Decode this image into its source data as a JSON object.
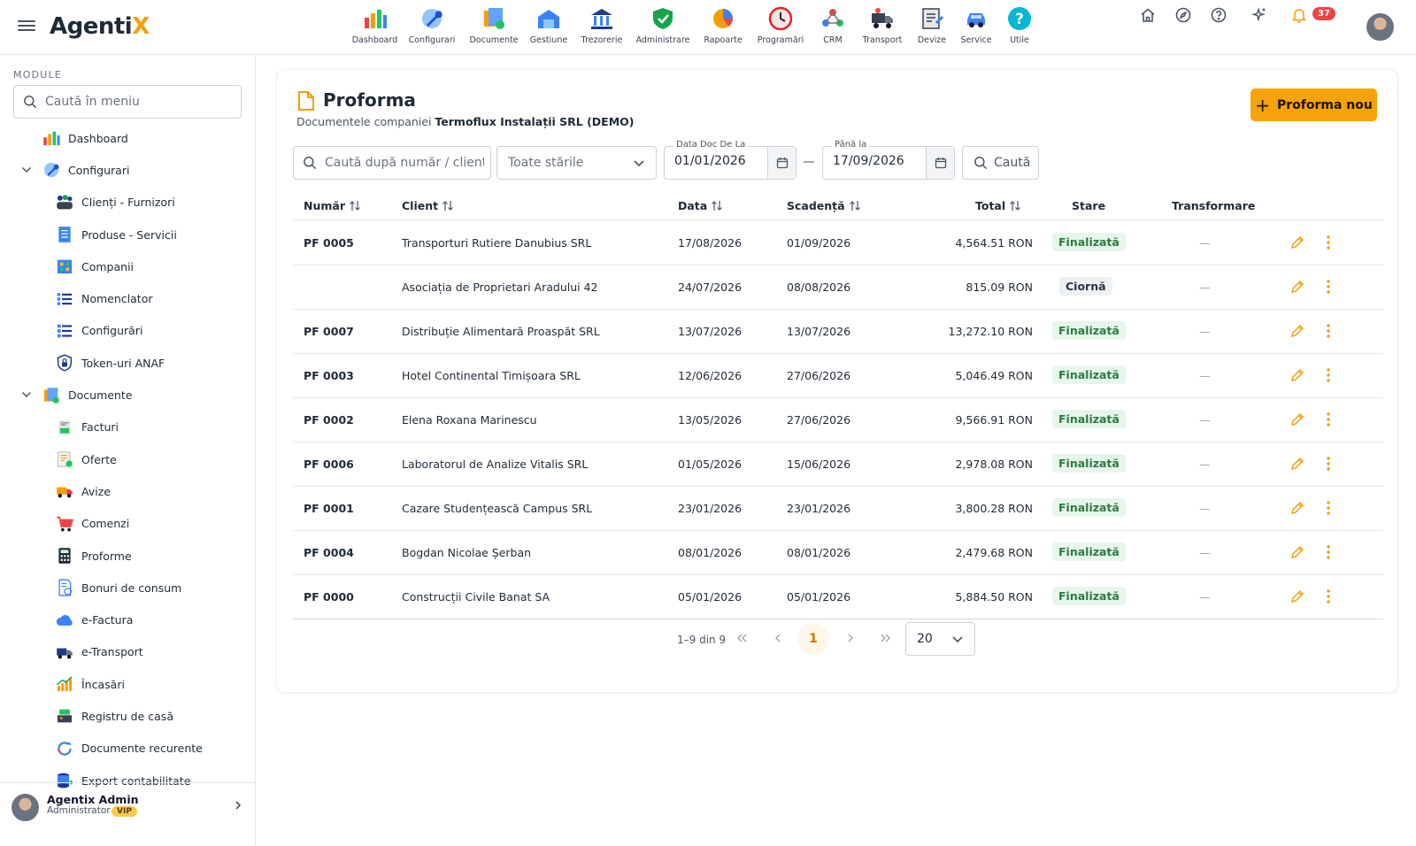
{
  "app": {
    "brand_main": "Agenti",
    "brand_accent": "X",
    "accent_color": "#f59e0b"
  },
  "topnav": [
    {
      "label": "Dashboard",
      "icon": "dashboard-icon"
    },
    {
      "label": "Configurari",
      "icon": "wrench-icon"
    },
    {
      "label": "Documente",
      "icon": "documents-icon"
    },
    {
      "label": "Gestiune",
      "icon": "warehouse-icon"
    },
    {
      "label": "Trezorerie",
      "icon": "bank-icon"
    },
    {
      "label": "Administrare",
      "icon": "shield-icon"
    },
    {
      "label": "Rapoarte",
      "icon": "pie-chart-icon"
    },
    {
      "label": "Programări",
      "icon": "clock-icon"
    },
    {
      "label": "CRM",
      "icon": "crm-icon"
    },
    {
      "label": "Transport",
      "icon": "truck-icon"
    },
    {
      "label": "Devize",
      "icon": "estimate-icon"
    },
    {
      "label": "Service",
      "icon": "car-service-icon"
    },
    {
      "label": "Utile",
      "icon": "help-icon"
    }
  ],
  "topright": {
    "notifications": "37"
  },
  "sidebar": {
    "module_label": "MODULE",
    "search_placeholder": "Caută în meniu",
    "items": [
      {
        "label": "Dashboard",
        "level": 0,
        "icon": "dashboard-icon"
      },
      {
        "label": "Configurari",
        "level": 0,
        "icon": "wrench-icon",
        "expanded": true
      },
      {
        "label": "Clienți - Furnizori",
        "level": 1,
        "icon": "people-icon"
      },
      {
        "label": "Produse - Servicii",
        "level": 1,
        "icon": "catalog-icon"
      },
      {
        "label": "Companii",
        "level": 1,
        "icon": "company-icon"
      },
      {
        "label": "Nomenclator",
        "level": 1,
        "icon": "list-icon"
      },
      {
        "label": "Configurări",
        "level": 1,
        "icon": "settings-list-icon"
      },
      {
        "label": "Token-uri ANAF",
        "level": 1,
        "icon": "shield-lock-icon"
      },
      {
        "label": "Documente",
        "level": 0,
        "icon": "documents-icon",
        "expanded": true
      },
      {
        "label": "Facturi",
        "level": 1,
        "icon": "invoice-icon"
      },
      {
        "label": "Oferte",
        "level": 1,
        "icon": "offer-icon"
      },
      {
        "label": "Avize",
        "level": 1,
        "icon": "delivery-truck-icon"
      },
      {
        "label": "Comenzi",
        "level": 1,
        "icon": "cart-icon"
      },
      {
        "label": "Proforme",
        "level": 1,
        "icon": "calculator-icon"
      },
      {
        "label": "Bonuri de consum",
        "level": 1,
        "icon": "receipt-icon"
      },
      {
        "label": "e-Factura",
        "level": 1,
        "icon": "cloud-icon"
      },
      {
        "label": "e-Transport",
        "level": 1,
        "icon": "transport-icon"
      },
      {
        "label": "Încasări",
        "level": 1,
        "icon": "growth-chart-icon"
      },
      {
        "label": "Registru de casă",
        "level": 1,
        "icon": "cash-register-icon"
      },
      {
        "label": "Documente recurente",
        "level": 1,
        "icon": "refresh-icon"
      },
      {
        "label": "Export contabilitate",
        "level": 1,
        "icon": "database-export-icon"
      }
    ],
    "user": {
      "name": "Agentix Admin",
      "role": "Administrator",
      "badge": "VIP"
    }
  },
  "page": {
    "title": "Proforma",
    "subtitle_prefix": "Documentele companiei ",
    "company": "Termoflux Instalații SRL (DEMO)",
    "new_button": "Proforma nou"
  },
  "filters": {
    "search_placeholder": "Caută după număr / client",
    "state_value": "Toate stările",
    "date_from_label": "Data Doc De La",
    "date_from": "01/01/2026",
    "date_to_label": "Până la",
    "date_to": "17/09/2026",
    "search_button": "Caută"
  },
  "table": {
    "columns": {
      "number": "Număr",
      "client": "Client",
      "date": "Data",
      "due": "Scadență",
      "total": "Total",
      "state": "Stare",
      "transform": "Transformare"
    },
    "rows": [
      {
        "number": "PF 0005",
        "client": "Transporturi Rutiere Danubius SRL",
        "date": "17/08/2026",
        "due": "01/09/2026",
        "total": "4,564.51 RON",
        "state": "Finalizată",
        "state_kind": "fin",
        "transform": "—"
      },
      {
        "number": "",
        "client": "Asociația de Proprietari Aradului 42",
        "date": "24/07/2026",
        "due": "08/08/2026",
        "total": "815.09 RON",
        "state": "Ciornă",
        "state_kind": "cio",
        "transform": "—"
      },
      {
        "number": "PF 0007",
        "client": "Distribuție Alimentară Proaspăt SRL",
        "date": "13/07/2026",
        "due": "13/07/2026",
        "total": "13,272.10 RON",
        "state": "Finalizată",
        "state_kind": "fin",
        "transform": "—"
      },
      {
        "number": "PF 0003",
        "client": "Hotel Continental Timișoara SRL",
        "date": "12/06/2026",
        "due": "27/06/2026",
        "total": "5,046.49 RON",
        "state": "Finalizată",
        "state_kind": "fin",
        "transform": "—"
      },
      {
        "number": "PF 0002",
        "client": "Elena Roxana Marinescu",
        "date": "13/05/2026",
        "due": "27/06/2026",
        "total": "9,566.91 RON",
        "state": "Finalizată",
        "state_kind": "fin",
        "transform": "—"
      },
      {
        "number": "PF 0006",
        "client": "Laboratorul de Analize Vitalis SRL",
        "date": "01/05/2026",
        "due": "15/06/2026",
        "total": "2,978.08 RON",
        "state": "Finalizată",
        "state_kind": "fin",
        "transform": "—"
      },
      {
        "number": "PF 0001",
        "client": "Cazare Studențească Campus SRL",
        "date": "23/01/2026",
        "due": "23/01/2026",
        "total": "3,800.28 RON",
        "state": "Finalizată",
        "state_kind": "fin",
        "transform": "—"
      },
      {
        "number": "PF 0004",
        "client": "Bogdan Nicolae Șerban",
        "date": "08/01/2026",
        "due": "08/01/2026",
        "total": "2,479.68 RON",
        "state": "Finalizată",
        "state_kind": "fin",
        "transform": "—"
      },
      {
        "number": "PF 0000",
        "client": "Construcții Civile Banat SA",
        "date": "05/01/2026",
        "due": "05/01/2026",
        "total": "5,884.50 RON",
        "state": "Finalizată",
        "state_kind": "fin",
        "transform": "—"
      }
    ]
  },
  "pagination": {
    "range": "1–9 din 9",
    "current": "1",
    "page_size": "20"
  }
}
